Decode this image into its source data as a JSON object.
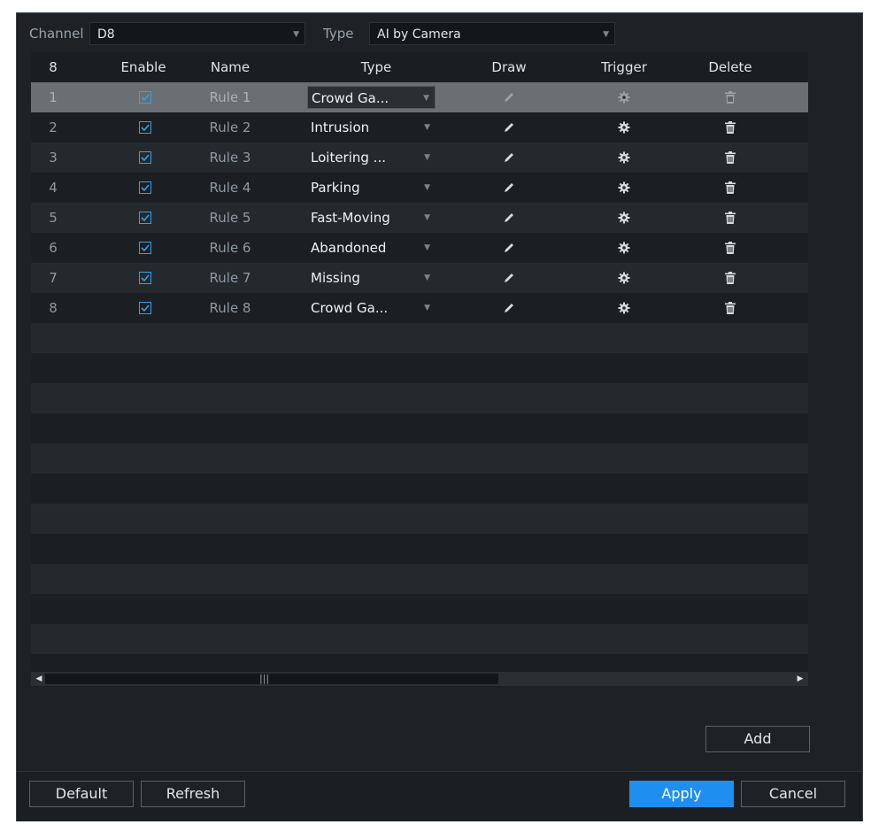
{
  "header": {
    "channel_label": "Channel",
    "channel_value": "D8",
    "type_label": "Type",
    "type_value": "AI by Camera"
  },
  "table": {
    "columns": [
      "8",
      "Enable",
      "Name",
      "Type",
      "Draw",
      "Trigger",
      "Delete"
    ],
    "rows": [
      {
        "num": "1",
        "enabled": true,
        "name": "Rule 1",
        "type": "Crowd Ga..."
      },
      {
        "num": "2",
        "enabled": true,
        "name": "Rule 2",
        "type": "Intrusion"
      },
      {
        "num": "3",
        "enabled": true,
        "name": "Rule 3",
        "type": "Loitering ..."
      },
      {
        "num": "4",
        "enabled": true,
        "name": "Rule 4",
        "type": "Parking"
      },
      {
        "num": "5",
        "enabled": true,
        "name": "Rule 5",
        "type": "Fast-Moving"
      },
      {
        "num": "6",
        "enabled": true,
        "name": "Rule 6",
        "type": "Abandoned"
      },
      {
        "num": "7",
        "enabled": true,
        "name": "Rule 7",
        "type": "Missing"
      },
      {
        "num": "8",
        "enabled": true,
        "name": "Rule 8",
        "type": "Crowd Ga..."
      }
    ],
    "selected_row": 1
  },
  "icons": {
    "draw": "pencil-icon",
    "trigger": "gear-icon",
    "delete": "trash-icon",
    "check": "checkbox-check-icon",
    "dropdown": "chevron-down-icon"
  },
  "buttons": {
    "add": "Add",
    "default": "Default",
    "refresh": "Refresh",
    "apply": "Apply",
    "cancel": "Cancel"
  },
  "colors": {
    "accent": "#1e8ff0",
    "checkbox": "#36a0e6",
    "panel_bg": "#1e2226",
    "selected_row": "#6a6f74"
  }
}
